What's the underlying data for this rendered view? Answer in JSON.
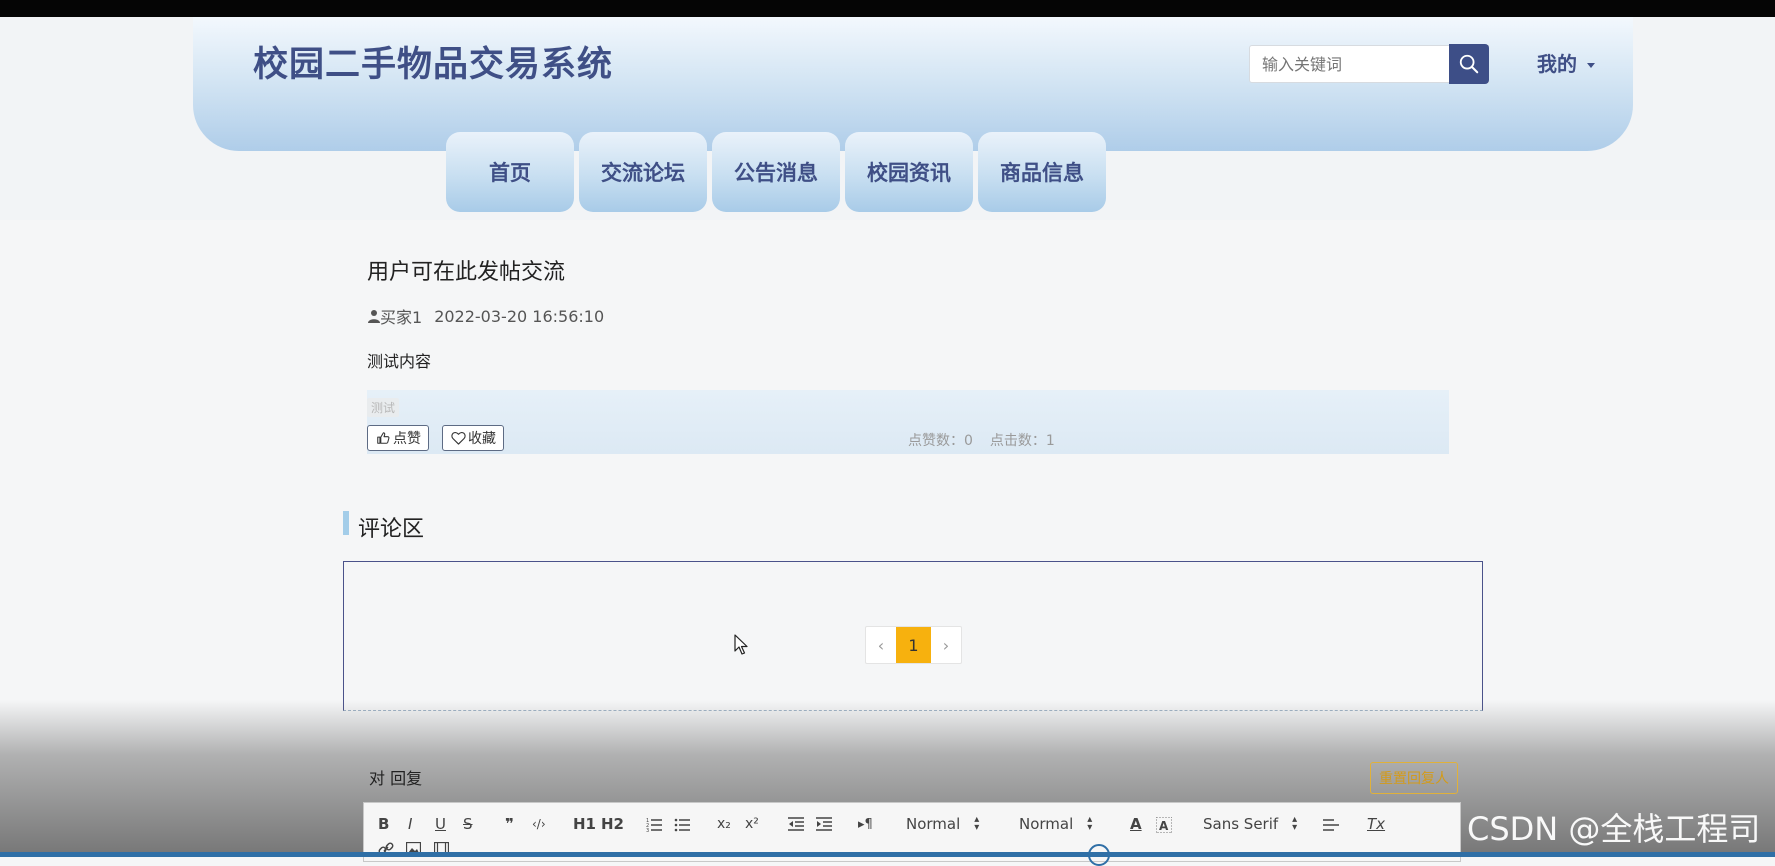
{
  "header": {
    "site_title": "校园二手物品交易系统",
    "search_placeholder": "输入关键词",
    "user_menu": "我的",
    "nav_items": [
      "首页",
      "交流论坛",
      "公告消息",
      "校园资讯",
      "商品信息"
    ]
  },
  "post": {
    "title": "用户可在此发帖交流",
    "author": "买家1",
    "time": "2022-03-20 16:56:10",
    "content": "测试内容",
    "tag": "测试",
    "like_label": "点赞",
    "favorite_label": "收藏",
    "like_count_label": "点赞数：0",
    "click_count_label": "点击数：1"
  },
  "comments": {
    "section_title": "评论区",
    "pagination": {
      "current_page": "1",
      "prev": "‹",
      "next": "›"
    }
  },
  "reply": {
    "label": "对 回复",
    "reset_button": "重置回复人",
    "toolbar": {
      "bold": "B",
      "italic": "I",
      "underline": "U",
      "strike": "S",
      "blockquote": "❞",
      "code": "‹/›",
      "h1": "H1",
      "h2": "H2",
      "subscript": "x₂",
      "superscript": "x²",
      "rtl": "▸¶",
      "header_select": "Normal",
      "size_select": "Normal",
      "font_select": "Sans Serif",
      "color": "A",
      "clean": "Tx"
    }
  },
  "watermark": "CSDN @全栈工程司",
  "colors": {
    "brand_text": "#3f4f86",
    "nav_gradient_top": "#eaf2fa",
    "nav_gradient_bottom": "#a8cbe8",
    "pager_active": "#f7b10e",
    "reset_border": "#e0b13a"
  }
}
